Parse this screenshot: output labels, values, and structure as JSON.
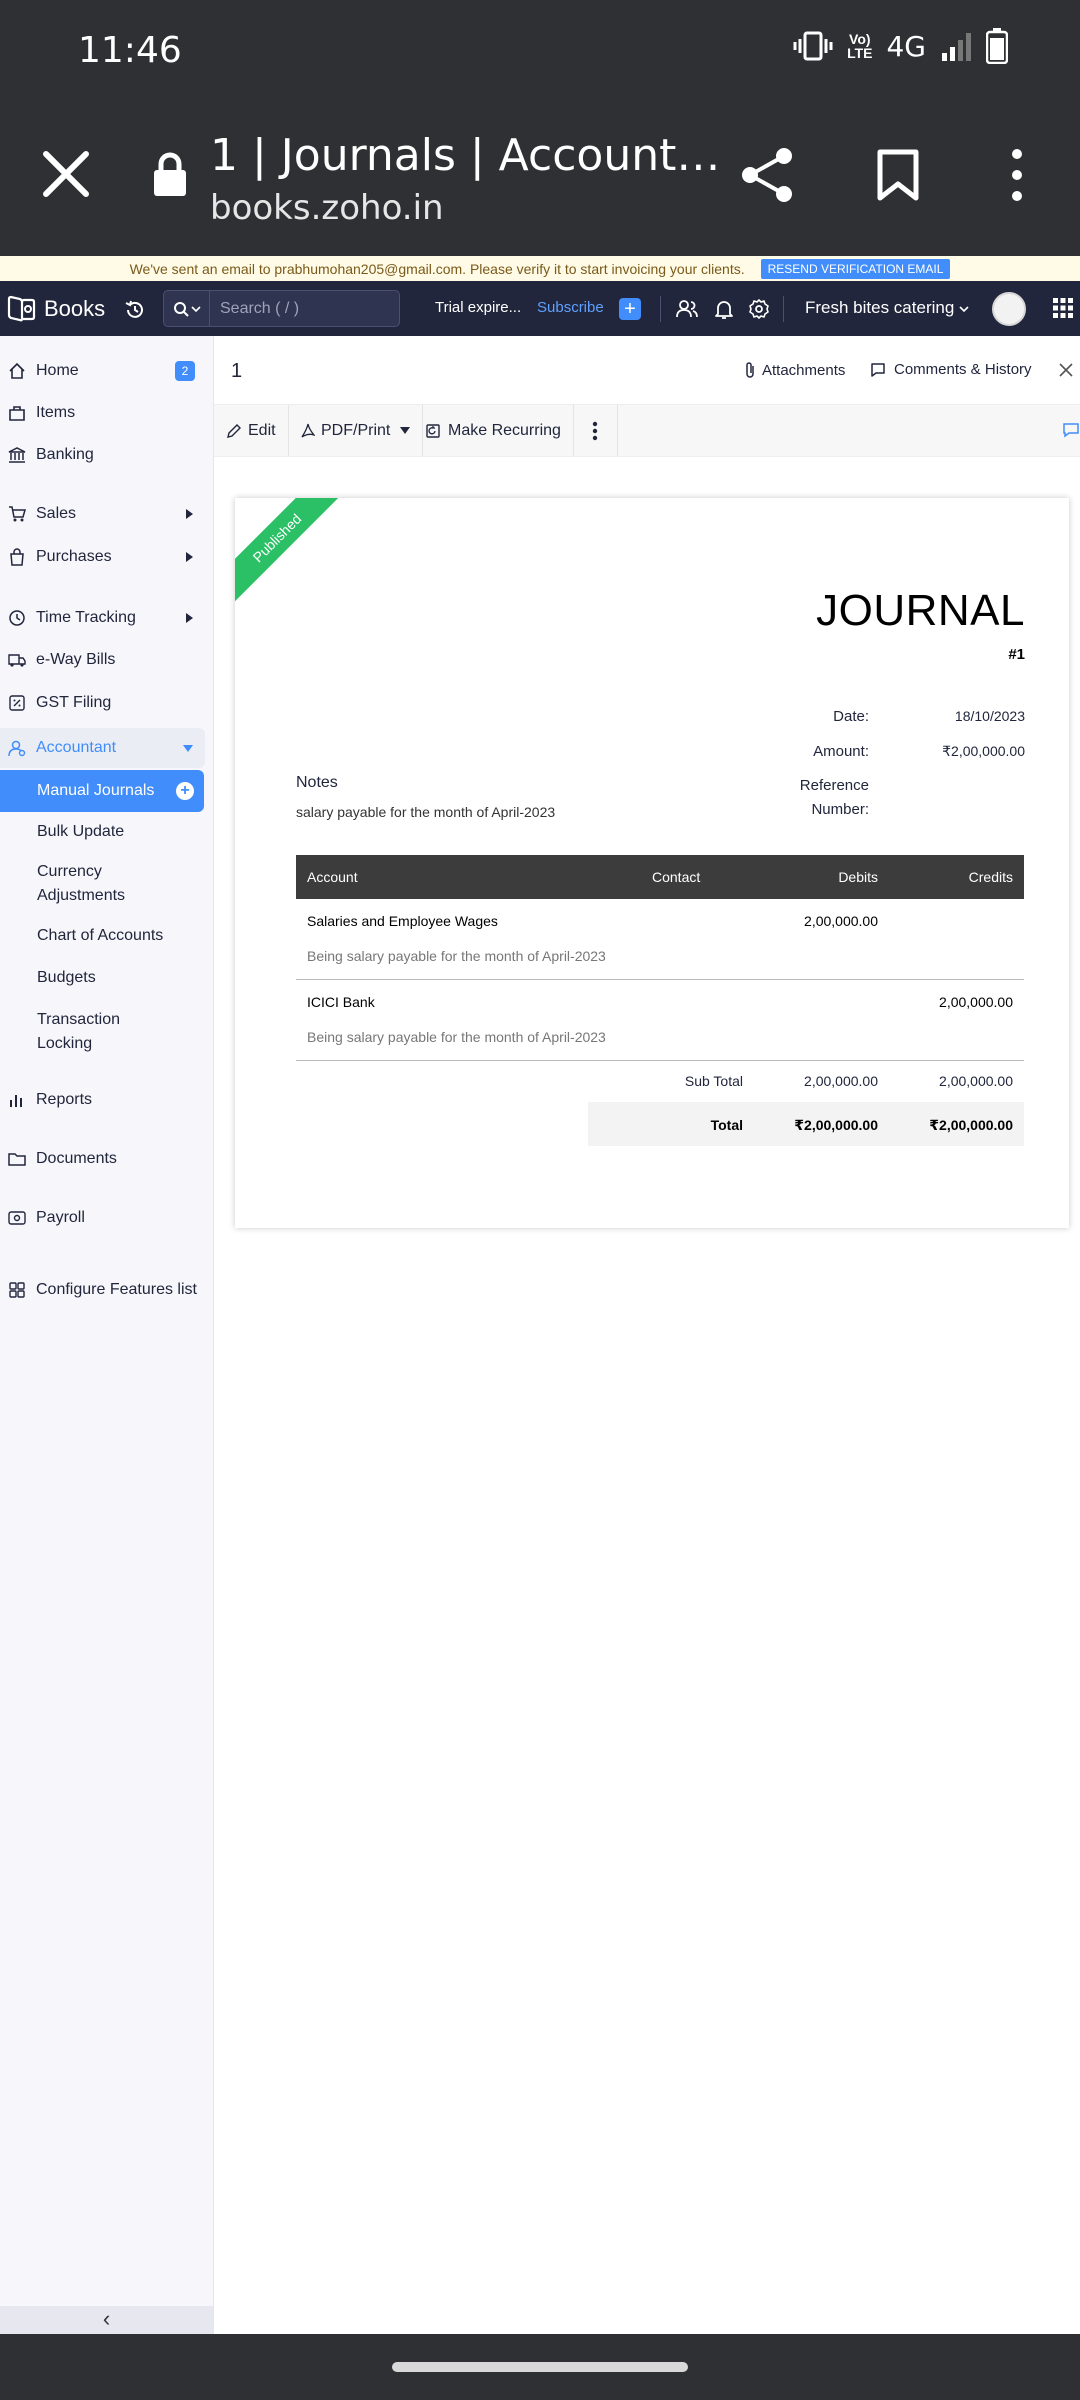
{
  "status_bar": {
    "time": "11:46",
    "network": "4G",
    "volte_top": "Vo)",
    "volte_bottom": "LTE"
  },
  "browser": {
    "tab_title": "1 | Journals | Account…",
    "url": "books.zoho.in"
  },
  "banner": {
    "message": "We've sent an email to prabhumohan205@gmail.com. Please verify it to start invoicing your clients.",
    "resend_label": "RESEND VERIFICATION EMAIL"
  },
  "header": {
    "brand": "Books",
    "search_placeholder": "Search ( / )",
    "trial_text": "Trial expire...",
    "subscribe_label": "Subscribe",
    "add_label": "+",
    "organization": "Fresh bites catering"
  },
  "sidebar": {
    "home": "Home",
    "home_badge": "2",
    "items_label": "Items",
    "banking": "Banking",
    "sales": "Sales",
    "purchases": "Purchases",
    "time_tracking": "Time Tracking",
    "eway_bills": "e-Way Bills",
    "gst_filing": "GST Filing",
    "accountant": "Accountant",
    "manual_journals": "Manual Journals",
    "bulk_update": "Bulk Update",
    "currency_adjustments": "Currency Adjustments",
    "chart_of_accounts": "Chart of Accounts",
    "budgets": "Budgets",
    "transaction_locking": "Transaction Locking",
    "reports": "Reports",
    "documents": "Documents",
    "payroll": "Payroll",
    "configure": "Configure Features list",
    "collapse_glyph": "‹"
  },
  "record": {
    "id": "1",
    "attachments_label": "Attachments",
    "comments_label": "Comments & History"
  },
  "toolbar": {
    "edit": "Edit",
    "pdf_print": "PDF/Print",
    "make_recurring": "Make Recurring"
  },
  "journal": {
    "status_ribbon": "Published",
    "heading": "JOURNAL",
    "number": "#1",
    "date_label": "Date:",
    "date_value": "18/10/2023",
    "amount_label": "Amount:",
    "amount_value": "₹2,00,000.00",
    "reference_label_1": "Reference",
    "reference_label_2": "Number:",
    "notes_label": "Notes",
    "notes_value": "salary payable for the month of April-2023",
    "columns": {
      "account": "Account",
      "contact": "Contact",
      "debits": "Debits",
      "credits": "Credits"
    },
    "rows": [
      {
        "account": "Salaries and Employee Wages",
        "description": "Being salary payable for the month of April-2023",
        "debit": "2,00,000.00",
        "credit": ""
      },
      {
        "account": "ICICI Bank",
        "description": "Being salary payable for the month of April-2023",
        "debit": "",
        "credit": "2,00,000.00"
      }
    ],
    "sub_total_label": "Sub Total",
    "sub_total_debit": "2,00,000.00",
    "sub_total_credit": "2,00,000.00",
    "total_label": "Total",
    "total_debit": "₹2,00,000.00",
    "total_credit": "₹2,00,000.00"
  },
  "colors": {
    "accent": "#408dfb",
    "header_bg": "#21263c",
    "published": "#2bc065",
    "table_header": "#3c3c3c"
  }
}
